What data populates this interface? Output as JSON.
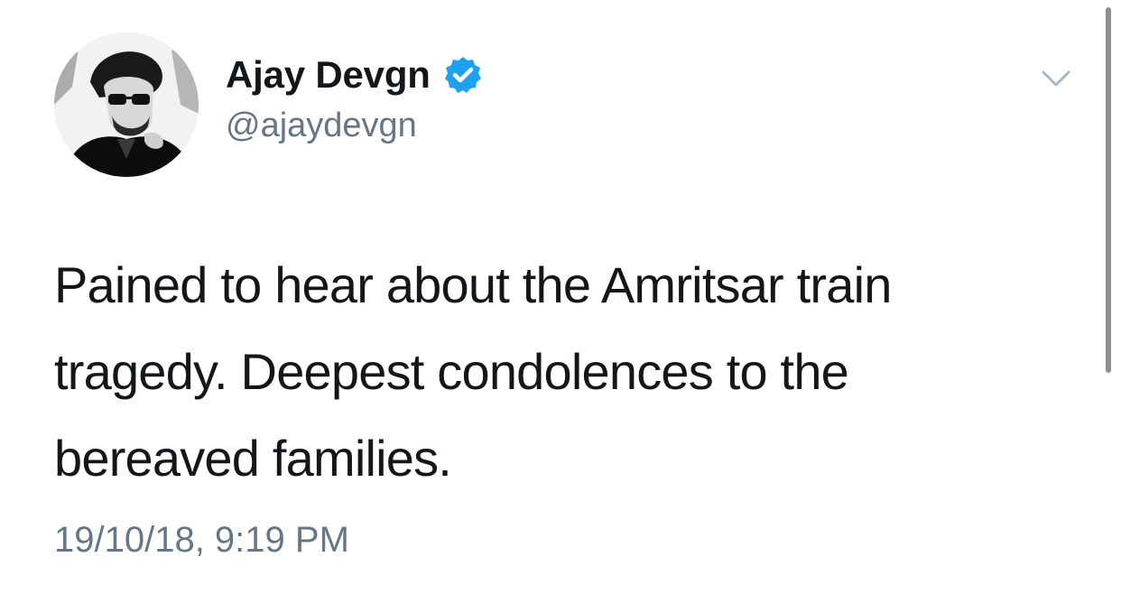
{
  "tweet": {
    "display_name": "Ajay Devgn",
    "handle": "@ajaydevgn",
    "text": "Pained to hear about the Amritsar train tragedy. Deepest condolences to the bereaved families.",
    "timestamp": "19/10/18, 9:19 PM"
  },
  "icons": {
    "verified": "verified-badge-icon",
    "caret": "chevron-down-icon"
  },
  "colors": {
    "name": "#14171a",
    "secondary": "#657786",
    "verified_blue": "#1da1f2",
    "caret": "#aab8c2"
  }
}
